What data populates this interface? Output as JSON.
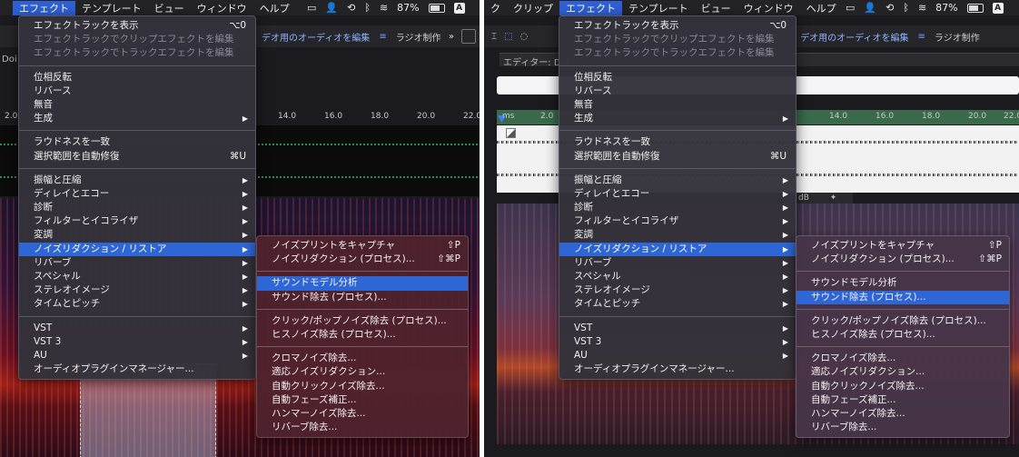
{
  "menubar": {
    "left": {
      "items": [
        "",
        "エフェクト",
        "テンプレート",
        "ビュー",
        "ウィンドウ",
        "ヘルプ"
      ],
      "battery": "87%"
    },
    "right": {
      "items": [
        "ク",
        "クリップ",
        "エフェクト",
        "テンプレート",
        "ビュー",
        "ウィンドウ",
        "ヘルプ"
      ],
      "battery": "87%"
    },
    "keyboard_indicator": "A"
  },
  "toolbar": {
    "tab_active": "デオ用のオーディオを編集",
    "tab_other": "ラジオ制作",
    "separator": "≡",
    "more": "»"
  },
  "editor": {
    "label_left": "Doi",
    "label_right": "エディター: Doi",
    "db": "dB"
  },
  "ruler": {
    "left": [
      "2.0",
      "14.0",
      "16.0",
      "18.0",
      "20.0",
      "22.0"
    ],
    "right": [
      "ms",
      "2.0",
      "14.0",
      "16.0",
      "18.0",
      "20.0",
      "22.0"
    ]
  },
  "effects_menu": {
    "groups": [
      [
        {
          "label": "エフェクトラックを表示",
          "shortcut": "⌥0"
        },
        {
          "label": "エフェクトラックでクリップエフェクトを編集",
          "disabled": true
        },
        {
          "label": "エフェクトラックでトラックエフェクトを編集",
          "disabled": true
        }
      ],
      [
        {
          "label": "位相反転"
        },
        {
          "label": "リバース"
        },
        {
          "label": "無音"
        },
        {
          "label": "生成",
          "submenu": true
        }
      ],
      [
        {
          "label": "ラウドネスを一致"
        },
        {
          "label": "選択範囲を自動修復",
          "shortcut": "⌘U"
        }
      ],
      [
        {
          "label": "振幅と圧縮",
          "submenu": true
        },
        {
          "label": "ディレイとエコー",
          "submenu": true
        },
        {
          "label": "診断",
          "submenu": true
        },
        {
          "label": "フィルターとイコライザ",
          "submenu": true
        },
        {
          "label": "変調",
          "submenu": true
        },
        {
          "label": "ノイズリダクション / リストア",
          "submenu": true,
          "highlight": true
        },
        {
          "label": "リバーブ",
          "submenu": true
        },
        {
          "label": "スペシャル",
          "submenu": true
        },
        {
          "label": "ステレオイメージ",
          "submenu": true
        },
        {
          "label": "タイムとピッチ",
          "submenu": true
        }
      ],
      [
        {
          "label": "VST",
          "submenu": true
        },
        {
          "label": "VST 3",
          "submenu": true
        },
        {
          "label": "AU",
          "submenu": true
        },
        {
          "label": "オーディオプラグインマネージャー..."
        }
      ]
    ]
  },
  "noise_submenu": {
    "groups": [
      [
        {
          "label": "ノイズプリントをキャプチャ",
          "shortcut": "⇧P"
        },
        {
          "label": "ノイズリダクション (プロセス)...",
          "shortcut": "⇧⌘P"
        }
      ],
      [
        {
          "label": "サウンドモデル分析"
        },
        {
          "label": "サウンド除去 (プロセス)..."
        }
      ],
      [
        {
          "label": "クリック/ポップノイズ除去 (プロセス)..."
        },
        {
          "label": "ヒスノイズ除去 (プロセス)..."
        }
      ],
      [
        {
          "label": "クロマノイズ除去..."
        },
        {
          "label": "適応ノイズリダクション..."
        },
        {
          "label": "自動クリックノイズ除去..."
        },
        {
          "label": "自動フェーズ補正..."
        },
        {
          "label": "ハンマーノイズ除去..."
        },
        {
          "label": "リバーブ除去..."
        }
      ]
    ]
  },
  "highlights": {
    "left_submenu": "サウンドモデル分析",
    "right_submenu": "サウンド除去 (プロセス)..."
  },
  "colors": {
    "accent": "#2f66d6"
  }
}
